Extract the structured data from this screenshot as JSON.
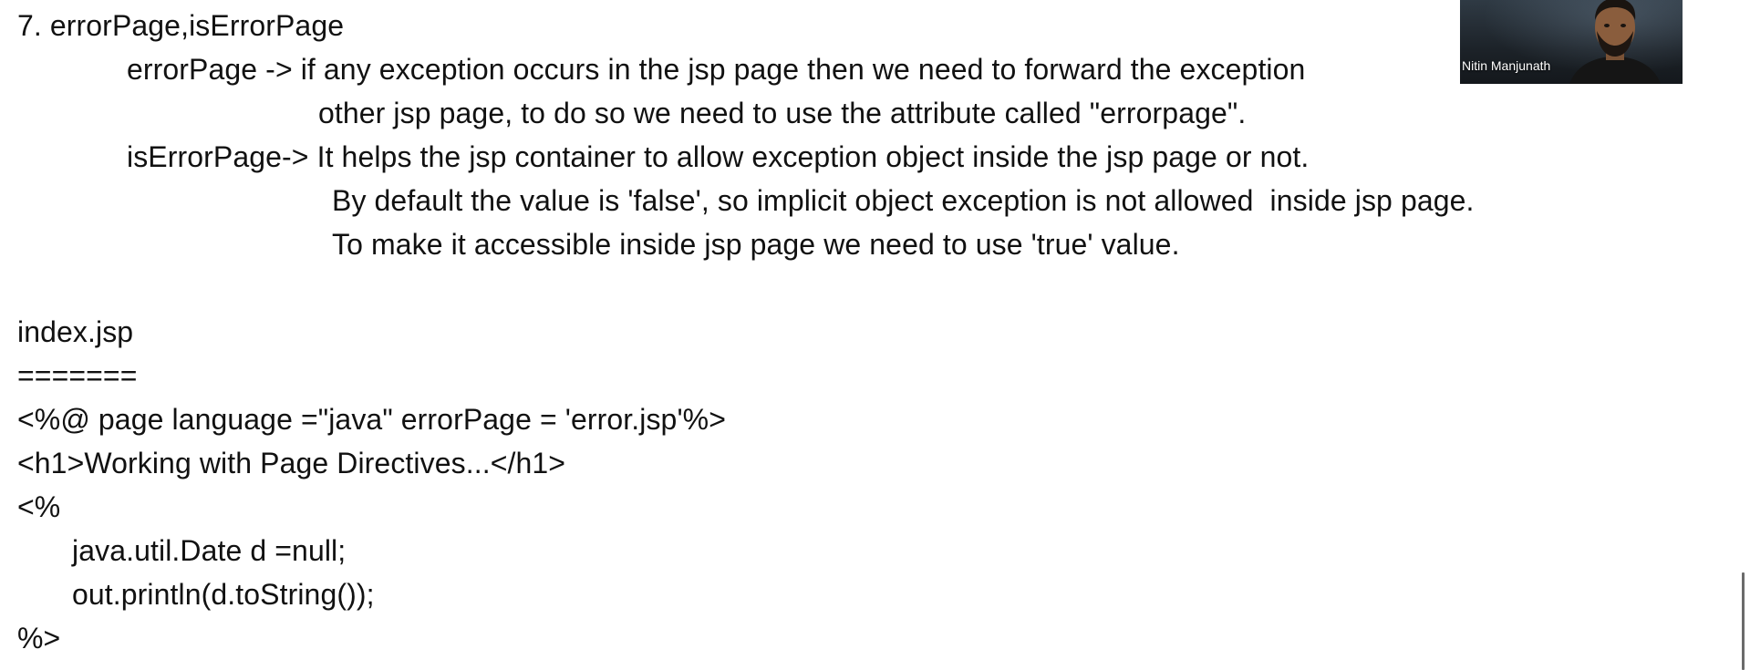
{
  "slide": {
    "heading": "7. errorPage,isErrorPage",
    "errorpage_line1": "errorPage -> if any exception occurs in the jsp page then we need to forward the exception",
    "errorpage_line2": "other jsp page, to do so we need to use the attribute called \"errorpage\".",
    "iserror_line1": "isErrorPage-> It helps the jsp container to allow exception object inside the jsp page or not.",
    "iserror_line2": "By default the value is 'false', so implicit object exception is not allowed  inside jsp page.",
    "iserror_line3": "To make it accessible inside jsp page we need to use 'true' value.",
    "file_name": "index.jsp",
    "underline": "=======",
    "code": [
      "<%@ page language =\"java\" errorPage = 'error.jsp'%>",
      "<h1>Working with Page Directives...</h1>",
      "<%",
      "java.util.Date d =null;",
      "out.println(d.toString());",
      "%>"
    ]
  },
  "webcam": {
    "participant_name": "Nitin Manjunath"
  }
}
